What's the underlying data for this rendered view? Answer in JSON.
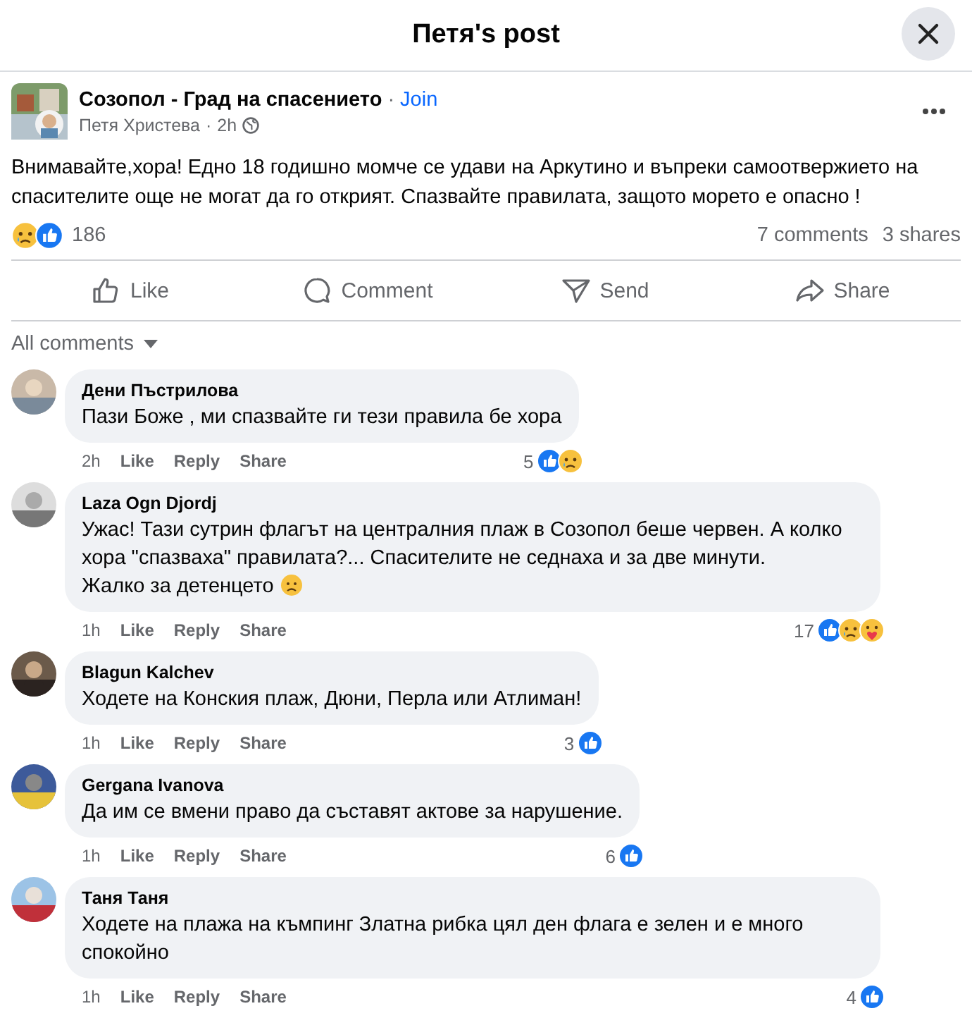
{
  "window": {
    "title": "Петя's post"
  },
  "post": {
    "group": "Созопол - Град на спасението",
    "join": "Join",
    "author": "Петя Христева",
    "time": "2h",
    "text": "Внимавайте,хора! Едно 18 годишно момче се удави на Аркутино и въпреки самоотвержието на спасителите още не могат да го открият. Спазвайте правилата, защото морето е опасно !",
    "separator": "·",
    "reactions": [
      {
        "kind": "sad"
      },
      {
        "kind": "like"
      }
    ],
    "reaction_count": "186",
    "comments_count": "7 comments",
    "shares_count": "3 shares"
  },
  "actions": [
    {
      "kind": "like",
      "label": "Like"
    },
    {
      "kind": "comment",
      "label": "Comment"
    },
    {
      "kind": "send",
      "label": "Send"
    },
    {
      "kind": "share",
      "label": "Share"
    }
  ],
  "filter": {
    "label": "All comments"
  },
  "comments": [
    {
      "author": "Дени Пъстрилова",
      "text": "Пази Боже , ми спазвайте ги тези правила бе хора",
      "time": "2h",
      "like": "Like",
      "reply": "Reply",
      "share": "Share",
      "count": "5",
      "reactions": [
        {
          "kind": "like"
        },
        {
          "kind": "sad"
        }
      ]
    },
    {
      "author": "Laza Ogn Djordj",
      "text": "Ужас! Тази сутрин флагът на централния плаж в Созопол беше червен. А колко хора \"спазваха\" правилата?... Спасителите не седнаха и за две минути.\nЖалко за детенцето",
      "inline_icons": [
        {
          "kind": "frown"
        }
      ],
      "time": "1h",
      "like": "Like",
      "reply": "Reply",
      "share": "Share",
      "count": "17",
      "reactions": [
        {
          "kind": "like"
        },
        {
          "kind": "sad"
        },
        {
          "kind": "care"
        }
      ]
    },
    {
      "author": "Blagun Kalchev",
      "text": "Ходете на Конския плаж, Дюни, Перла или Атлиман!",
      "time": "1h",
      "like": "Like",
      "reply": "Reply",
      "share": "Share",
      "count": "3",
      "reactions": [
        {
          "kind": "like"
        }
      ]
    },
    {
      "author": "Gergana Ivanova",
      "text": "Да им се вмени право да съставят актове за нарушение.",
      "time": "1h",
      "like": "Like",
      "reply": "Reply",
      "share": "Share",
      "count": "6",
      "reactions": [
        {
          "kind": "like"
        }
      ]
    },
    {
      "author": "Таня Таня",
      "text": "Ходете на плажа на къмпинг Златна рибка цял ден флага е зелен и е много спокойно",
      "time": "1h",
      "like": "Like",
      "reply": "Reply",
      "share": "Share",
      "count": "4",
      "reactions": [
        {
          "kind": "like"
        }
      ]
    }
  ]
}
